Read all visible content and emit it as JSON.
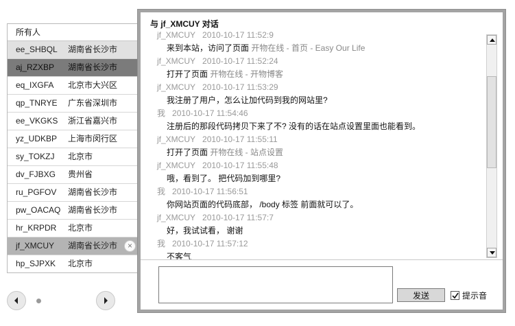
{
  "user_list": {
    "header": "所有人",
    "users": [
      {
        "name": "ee_SHBQL",
        "location": "湖南省长沙市"
      },
      {
        "name": "aj_RZXBP",
        "location": "湖南省长沙市"
      },
      {
        "name": "eq_IXGFA",
        "location": "北京市大兴区"
      },
      {
        "name": "qp_TNRYE",
        "location": "广东省深圳市"
      },
      {
        "name": "ee_VKGKS",
        "location": "浙江省嘉兴市"
      },
      {
        "name": "yz_UDKBP",
        "location": "上海市闵行区"
      },
      {
        "name": "sy_TOKZJ",
        "location": "北京市"
      },
      {
        "name": "dv_FJBXG",
        "location": "贵州省"
      },
      {
        "name": "ru_PGFOV",
        "location": "湖南省长沙市"
      },
      {
        "name": "pw_OACAQ",
        "location": "湖南省长沙市"
      },
      {
        "name": "hr_KRPDR",
        "location": "北京市"
      },
      {
        "name": "jf_XMCUY",
        "location": "湖南省长沙市"
      },
      {
        "name": "hp_SJPXK",
        "location": "北京市"
      }
    ],
    "close_glyph": "×"
  },
  "pager": {
    "prev_icon": "left-arrow-icon",
    "next_icon": "right-arrow-icon"
  },
  "chat": {
    "title": "与 jf_XMCUY 对话",
    "messages": [
      {
        "sender": "jf_XMCUY",
        "time": "2010-10-17 11:52:9",
        "text": "来到本站，访问了页面 ",
        "link": "开物在线 - 首页 - Easy Our Life"
      },
      {
        "sender": "jf_XMCUY",
        "time": "2010-10-17 11:52:24",
        "text": "打开了页面 ",
        "link": "开物在线 - 开物博客"
      },
      {
        "sender": "jf_XMCUY",
        "time": "2010-10-17 11:53:29",
        "text": "我注册了用户，怎么让加代码到我的网站里?",
        "link": ""
      },
      {
        "sender": "我",
        "time": "2010-10-17 11:54:46",
        "text": "注册后的那段代码拷贝下来了不? 没有的话在站点设置里面也能看到。",
        "link": ""
      },
      {
        "sender": "jf_XMCUY",
        "time": "2010-10-17 11:55:11",
        "text": "打开了页面 ",
        "link": "开物在线 - 站点设置"
      },
      {
        "sender": "jf_XMCUY",
        "time": "2010-10-17 11:55:48",
        "text": "哦，看到了。 把代码加到哪里?",
        "link": ""
      },
      {
        "sender": "我",
        "time": "2010-10-17 11:56:51",
        "text": "你网站页面的代码底部， /body 标签 前面就可以了。",
        "link": ""
      },
      {
        "sender": "jf_XMCUY",
        "time": "2010-10-17 11:57:7",
        "text": "好，我试试看， 谢谢",
        "link": ""
      },
      {
        "sender": "我",
        "time": "2010-10-17 11:57:12",
        "text": "不客气",
        "link": ""
      }
    ],
    "input_value": "",
    "send_label": "发送",
    "sound_label": "提示音",
    "sound_checked": true
  },
  "colors": {
    "frame": "#a3a3a3",
    "row_alt": "#e1e1e1",
    "row_active": "#7b7b7b",
    "row_selected": "#b4b4b4",
    "meta_text": "#999999"
  }
}
